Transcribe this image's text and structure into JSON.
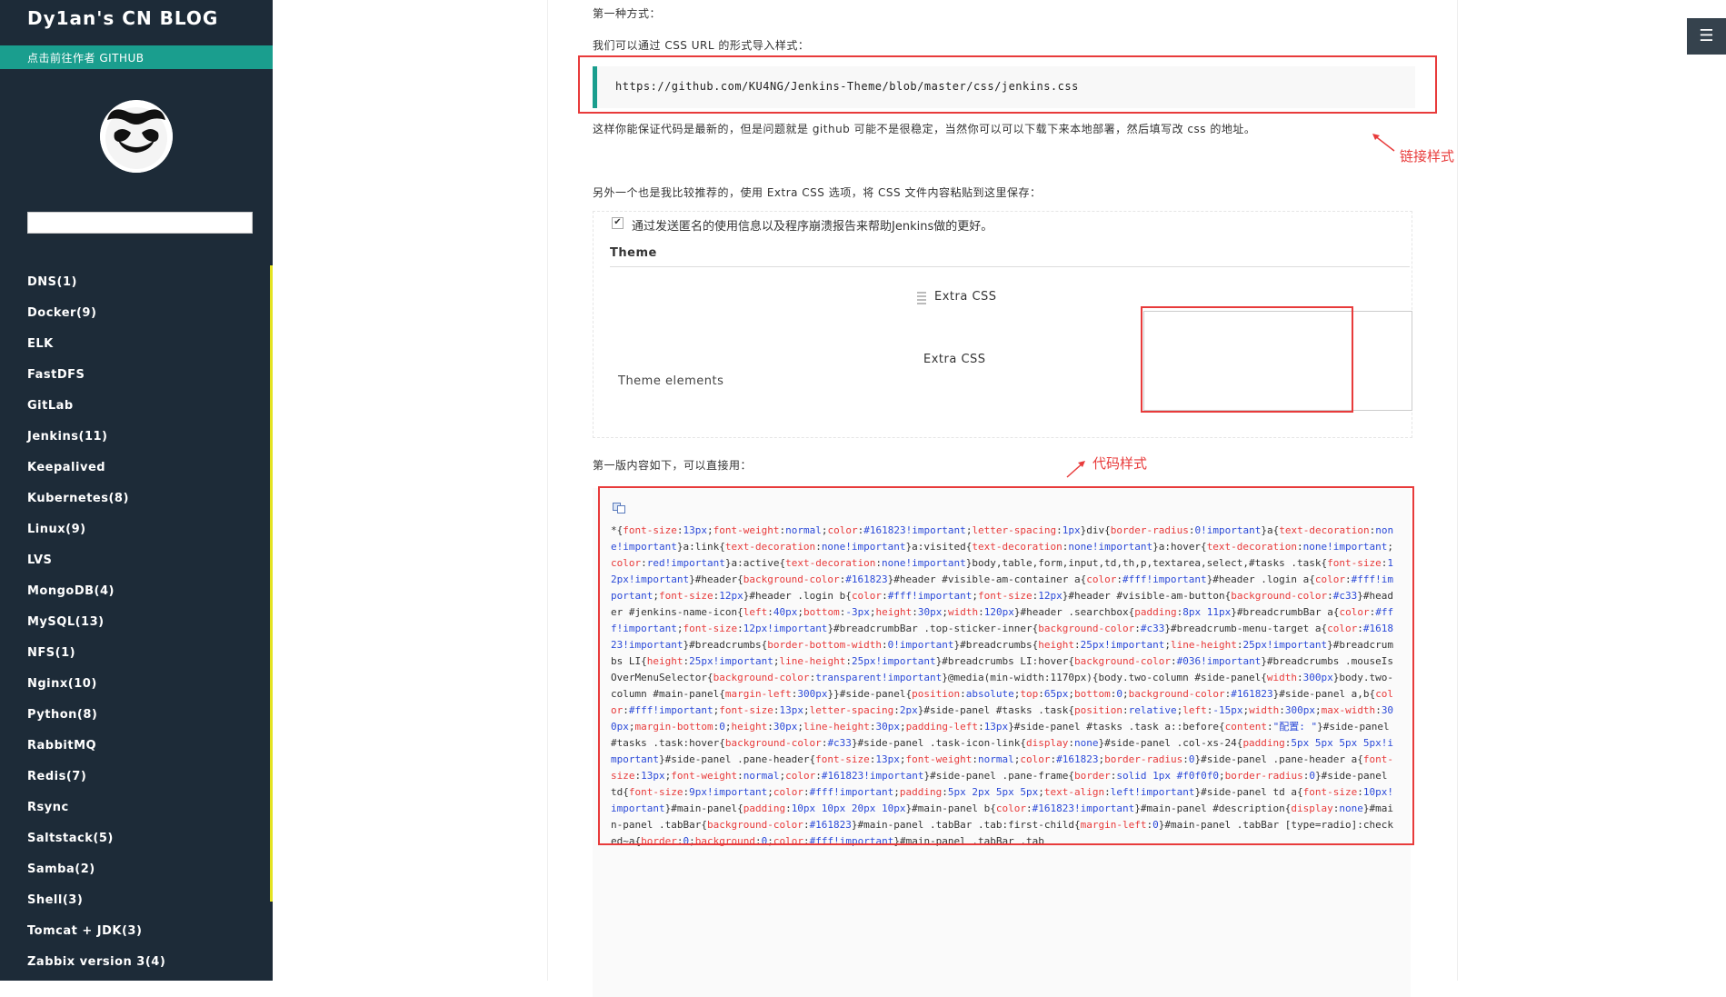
{
  "sidebar": {
    "title": "Dy1an's CN BLOG",
    "github_link": "点击前往作者 GITHUB",
    "search_value": "",
    "categories": [
      "DNS(1)",
      "Docker(9)",
      "ELK",
      "FastDFS",
      "GitLab",
      "Jenkins(11)",
      "Keepalived",
      "Kubernetes(8)",
      "Linux(9)",
      "LVS",
      "MongoDB(4)",
      "MySQL(13)",
      "NFS(1)",
      "Nginx(10)",
      "Python(8)",
      "RabbitMQ",
      "Redis(7)",
      "Rsync",
      "Saltstack(5)",
      "Samba(2)",
      "Shell(3)",
      "Tomcat + JDK(3)",
      "Zabbix version 3(4)"
    ]
  },
  "content": {
    "p_method1": "第一种方式：",
    "p_css_url": "我们可以通过 CSS URL 的形式导入样式：",
    "css_url": "https://github.com/KU4NG/Jenkins-Theme/blob/master/css/jenkins.css",
    "p_note": "这样你能保证代码是最新的，但是问题就是 github 可能不是很稳定，当然你可以可以下载下来本地部署，然后填写改 css 的地址。",
    "annot_link": "链接样式",
    "p_extra": "另外一个也是我比较推荐的，使用 Extra CSS 选项，将 CSS 文件内容粘贴到这里保存：",
    "jenkins": {
      "checkbox_label": "通过发送匿名的使用信息以及程序崩溃报告来帮助Jenkins做的更好。",
      "theme_heading": "Theme",
      "extra_css_label_1": "Extra CSS",
      "extra_css_label_2": "Extra CSS",
      "theme_elements": "Theme elements"
    },
    "p_version": "第一版内容如下，可以直接用：",
    "annot_code": "代码样式"
  },
  "menu_icon": "☰",
  "colors": {
    "sidebar_bg": "#1d2b38",
    "accent": "#1a9e8e",
    "annotation": "#e83b3b",
    "sidebar_rule": "#e4e321"
  }
}
